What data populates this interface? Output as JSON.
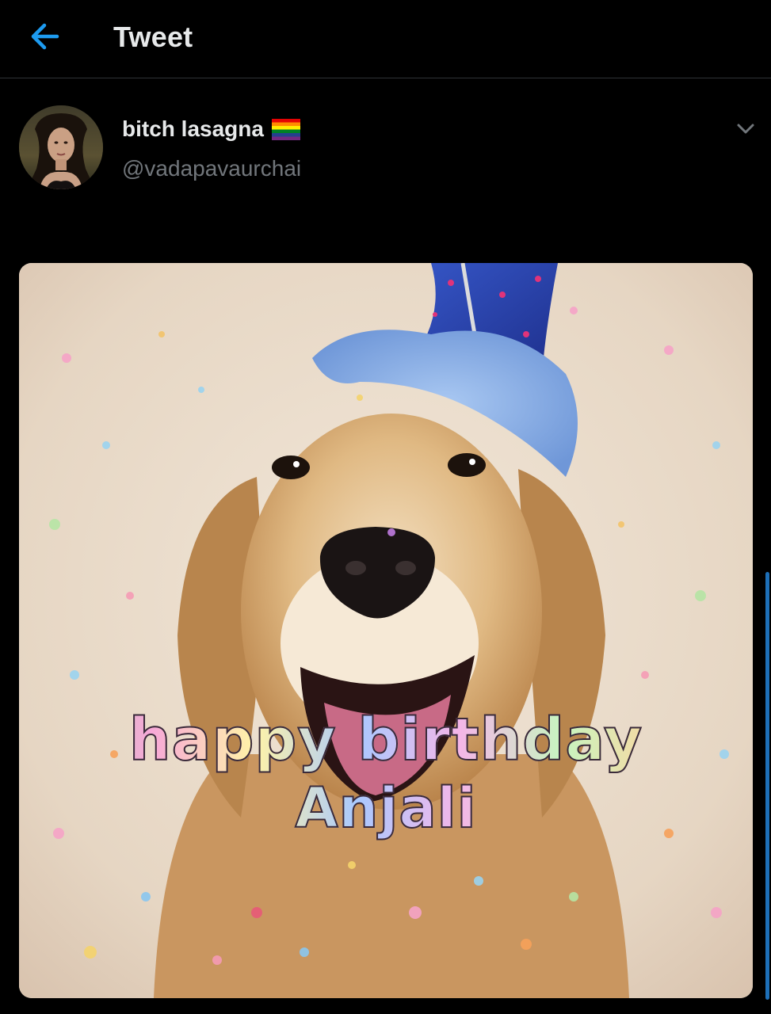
{
  "header": {
    "title": "Tweet",
    "back_icon": "arrow-left-icon",
    "accent_color": "#1d9bf0"
  },
  "tweet": {
    "author": {
      "display_name": "bitch lasagna",
      "handle": "@vadapavaurchai",
      "name_emoji": "rainbow-flag-icon"
    },
    "more_icon": "chevron-down-icon",
    "media": {
      "caption_line1": "happy birthday",
      "caption_line2": "Anjali"
    }
  },
  "colors": {
    "background": "#000000",
    "text_primary": "#e7e9ea",
    "text_secondary": "#71767b",
    "divider": "#2f3336"
  }
}
